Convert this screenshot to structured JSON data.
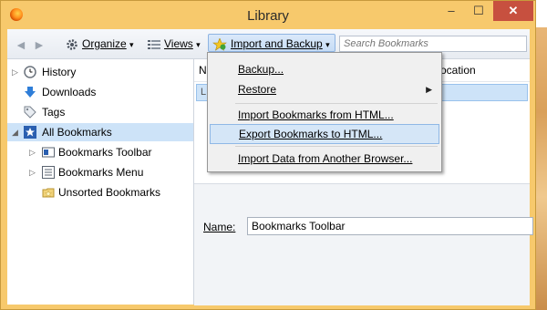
{
  "window": {
    "title": "Library",
    "minimize": "–",
    "maximize": "☐",
    "close": "✕"
  },
  "toolbar": {
    "back": "◄",
    "forward": "►",
    "organize": "Organize",
    "views": "Views",
    "import_backup": "Import and Backup",
    "caret": "▾",
    "search_placeholder": "Search Bookmarks"
  },
  "sidebar": {
    "items": [
      {
        "label": "History",
        "icon": "clock-icon",
        "twisty": "▷"
      },
      {
        "label": "Downloads",
        "icon": "download-arrow-icon",
        "twisty": ""
      },
      {
        "label": "Tags",
        "icon": "tag-icon",
        "twisty": ""
      },
      {
        "label": "All Bookmarks",
        "icon": "star-icon",
        "twisty": "◢"
      },
      {
        "label": "Bookmarks Toolbar",
        "icon": "bookmarks-toolbar-icon",
        "twisty": "▷"
      },
      {
        "label": "Bookmarks Menu",
        "icon": "bookmarks-menu-icon",
        "twisty": "▷"
      },
      {
        "label": "Unsorted Bookmarks",
        "icon": "unsorted-folder-icon",
        "twisty": ""
      }
    ]
  },
  "content": {
    "col_name": "Na",
    "col_location": "ocation",
    "row_icon_text": "L"
  },
  "details": {
    "name_label": "Name:",
    "name_value": "Bookmarks Toolbar"
  },
  "menu": {
    "backup": "Backup...",
    "restore": "Restore",
    "submenu_arrow": "▶",
    "import_html": "Import Bookmarks from HTML...",
    "export_html": "Export Bookmarks to HTML...",
    "import_browser": "Import Data from Another Browser..."
  }
}
